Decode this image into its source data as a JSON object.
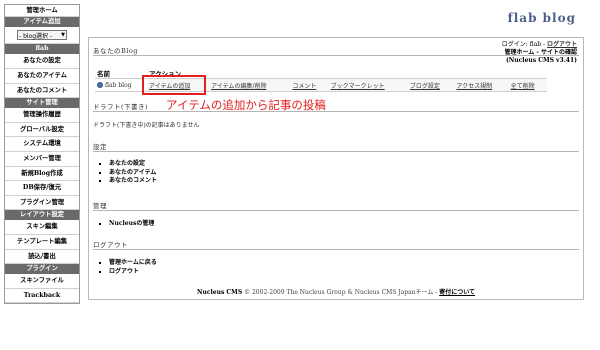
{
  "sidebar": {
    "items": [
      {
        "type": "item",
        "label": "管理ホーム"
      },
      {
        "type": "header",
        "label": "アイテム追加"
      },
      {
        "type": "select",
        "label": "- blog選択 -"
      },
      {
        "type": "header",
        "label": "flab"
      },
      {
        "type": "link",
        "label": "あなたの設定"
      },
      {
        "type": "link",
        "label": "あなたのアイテム"
      },
      {
        "type": "link",
        "label": "あなたのコメント"
      },
      {
        "type": "header",
        "label": "サイト管理"
      },
      {
        "type": "link",
        "label": "管理操作履歴"
      },
      {
        "type": "link",
        "label": "グローバル設定"
      },
      {
        "type": "link",
        "label": "システム環境"
      },
      {
        "type": "link",
        "label": "メンバー管理"
      },
      {
        "type": "link",
        "label": "新規Blog作成"
      },
      {
        "type": "link",
        "label": "DB保存/復元"
      },
      {
        "type": "link",
        "label": "プラグイン管理"
      },
      {
        "type": "header",
        "label": "レイアウト設定"
      },
      {
        "type": "link",
        "label": "スキン編集"
      },
      {
        "type": "link",
        "label": "テンプレート編集"
      },
      {
        "type": "link",
        "label": "読込/書出"
      },
      {
        "type": "header",
        "label": "プラグイン"
      },
      {
        "type": "link",
        "label": "スキンファイル"
      },
      {
        "type": "link",
        "label": "Trackback"
      }
    ]
  },
  "header": {
    "logo": "flab blog",
    "login_prefix": "ログイン: flab - ",
    "logout": "ログアウト",
    "admin_home": "管理ホーム",
    "sep": " - ",
    "view_site": "サイトの確認",
    "version": "(Nucleus CMS v3.41)"
  },
  "sections": {
    "your_blogs": "あなたのBlog",
    "drafts": "ドラフト(下書き)",
    "settings": "設定",
    "admin": "管理",
    "logout": "ログアウト"
  },
  "blog_table": {
    "columns": [
      "名前",
      "アクション"
    ],
    "rows": [
      {
        "name": "flab blog",
        "actions": [
          "アイテムの追加",
          "アイテムの編集/削除",
          "コメント",
          "ブックマークレット",
          "ブログ設定",
          "アクセス規制",
          "全て削除"
        ]
      }
    ]
  },
  "annotation": "アイテムの追加から記事の投稿",
  "drafts_text": "ドラフト(下書き中)の記事はありません",
  "settings_links": [
    "あなたの設定",
    "あなたのアイテム",
    "あなたのコメント"
  ],
  "admin_links": [
    "Nucleusの管理"
  ],
  "logout_links": [
    "管理ホームに戻る",
    "ログアウト"
  ],
  "footer": {
    "brand": "Nucleus CMS",
    "text": " © 2002-2009 The Nucleus Group & Nucleus CMS Japanチーム - ",
    "donate": "寄付について"
  },
  "colors": {
    "highlight": "#e31e1e",
    "logo": "#4a5f8a",
    "sidebar_header": "#6a6a6a"
  }
}
